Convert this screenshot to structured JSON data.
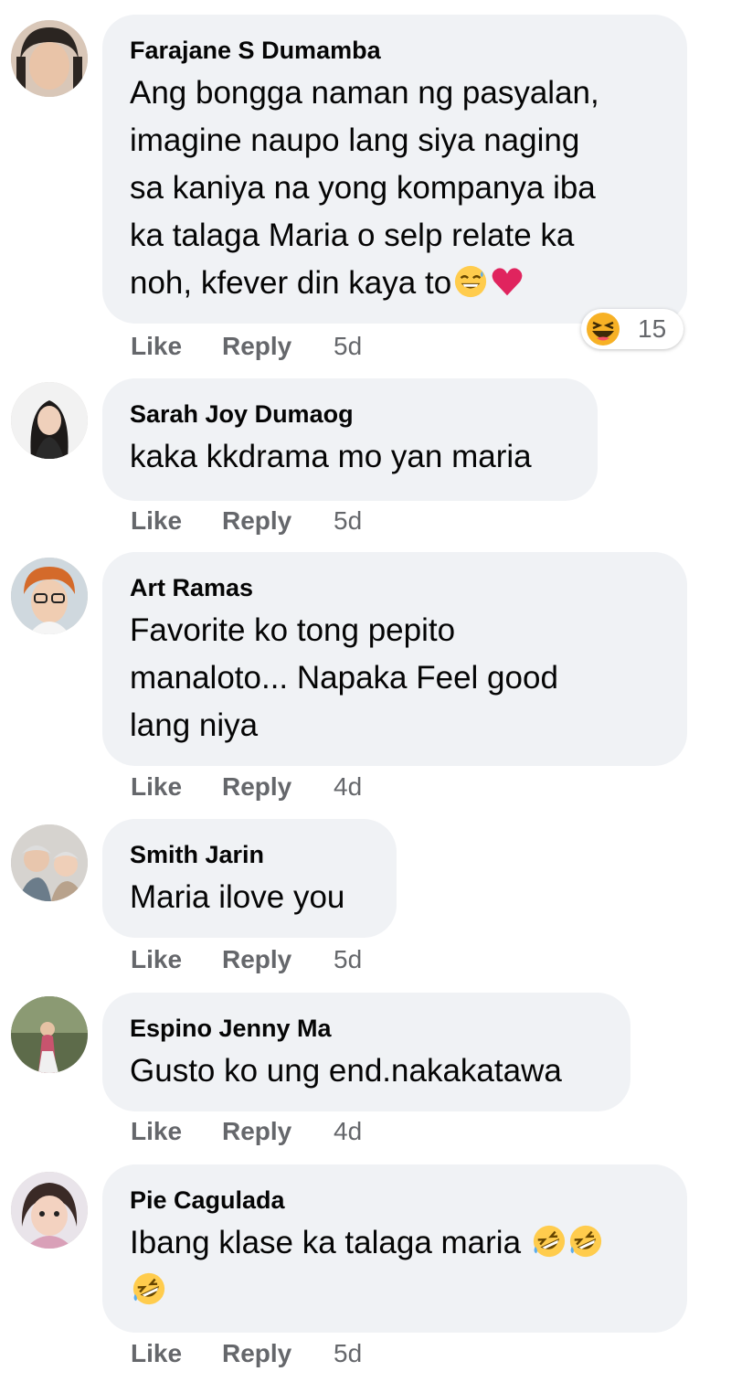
{
  "comments": [
    {
      "author": "Farajane S Dumamba",
      "text": "Ang bongga naman ng pasyalan,\nimagine naupo lang siya naging\nsa kaniya na yong kompanya iba\nka talaga Maria o selp relate ka\nnoh, kfever din kaya to",
      "emojis": [
        "grinning-sweat-emoji",
        "red-heart-emoji"
      ],
      "like_label": "Like",
      "reply_label": "Reply",
      "time": "5d",
      "reaction": {
        "icon": "haha-reaction-icon",
        "count": "15"
      }
    },
    {
      "author": "Sarah Joy Dumaog",
      "text": "kaka kkdrama mo yan maria",
      "like_label": "Like",
      "reply_label": "Reply",
      "time": "5d"
    },
    {
      "author": "Art Ramas",
      "text": "Favorite ko tong pepito\nmanaloto... Napaka Feel good\nlang niya",
      "like_label": "Like",
      "reply_label": "Reply",
      "time": "4d"
    },
    {
      "author": "Smith Jarin",
      "text": "Maria ilove you",
      "like_label": "Like",
      "reply_label": "Reply",
      "time": "5d"
    },
    {
      "author": "Espino Jenny Ma",
      "text": "Gusto ko ung end.nakakatawa",
      "like_label": "Like",
      "reply_label": "Reply",
      "time": "4d"
    },
    {
      "author": "Pie Cagulada",
      "text": "Ibang klase ka talaga maria",
      "emojis": [
        "rolling-laughing-emoji",
        "rolling-laughing-emoji",
        "rolling-laughing-emoji"
      ],
      "like_label": "Like",
      "reply_label": "Reply",
      "time": "5d"
    }
  ],
  "colors": {
    "bubble": "#f0f2f5",
    "meta_text": "#65676b",
    "primary_text": "#050505",
    "heart": "#e0245e",
    "emoji_yellow": "#ffcc4d"
  }
}
